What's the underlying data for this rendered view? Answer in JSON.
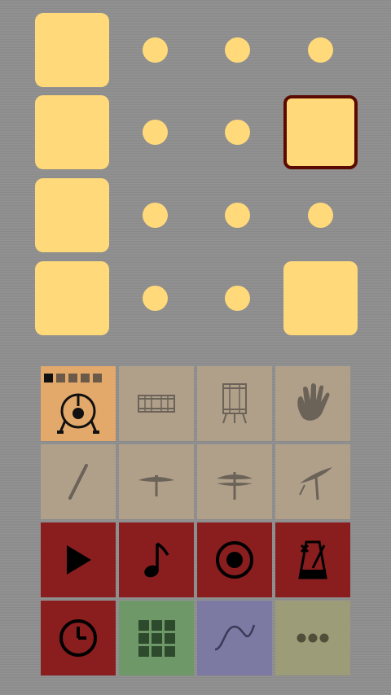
{
  "sequencer": {
    "rows": [
      [
        "pad",
        "dot",
        "dot",
        "dot"
      ],
      [
        "pad",
        "dot",
        "dot",
        "pad-selected"
      ],
      [
        "pad",
        "dot",
        "dot",
        "dot"
      ],
      [
        "pad",
        "dot",
        "dot",
        "pad"
      ]
    ]
  },
  "instruments": [
    {
      "name": "kick-drum",
      "icon": "kick-drum-icon",
      "active": true
    },
    {
      "name": "snare-drum",
      "icon": "snare-drum-icon",
      "active": false
    },
    {
      "name": "floor-tom",
      "icon": "floor-tom-icon",
      "active": false
    },
    {
      "name": "hand-clap",
      "icon": "hand-clap-icon",
      "active": false
    },
    {
      "name": "drumstick",
      "icon": "drumstick-icon",
      "active": false
    },
    {
      "name": "ride-cymbal",
      "icon": "ride-cymbal-icon",
      "active": false
    },
    {
      "name": "hi-hat",
      "icon": "hi-hat-icon",
      "active": false
    },
    {
      "name": "crash-cymbal",
      "icon": "crash-cymbal-icon",
      "active": false
    }
  ],
  "controls": [
    {
      "name": "play",
      "icon": "play-icon"
    },
    {
      "name": "note",
      "icon": "music-note-icon"
    },
    {
      "name": "record",
      "icon": "record-icon"
    },
    {
      "name": "metronome",
      "icon": "metronome-icon"
    },
    {
      "name": "tempo",
      "icon": "clock-icon"
    },
    {
      "name": "grid",
      "icon": "grid-icon"
    },
    {
      "name": "wave",
      "icon": "sine-wave-icon"
    },
    {
      "name": "more",
      "icon": "more-icon"
    }
  ],
  "active_instrument_steps": {
    "total": 5,
    "current": 1
  },
  "colors": {
    "background": "#8f8f8f",
    "pad": "#ffd97a",
    "pad_selected_border": "#5a0a00",
    "instrument_tile": "#b0a08a",
    "instrument_tile_active": "#e3a96a",
    "control_tile": "#8a1e1e",
    "grid_tile": "#6e9868",
    "wave_tile": "#7c79a2",
    "more_tile": "#9c9c78"
  }
}
